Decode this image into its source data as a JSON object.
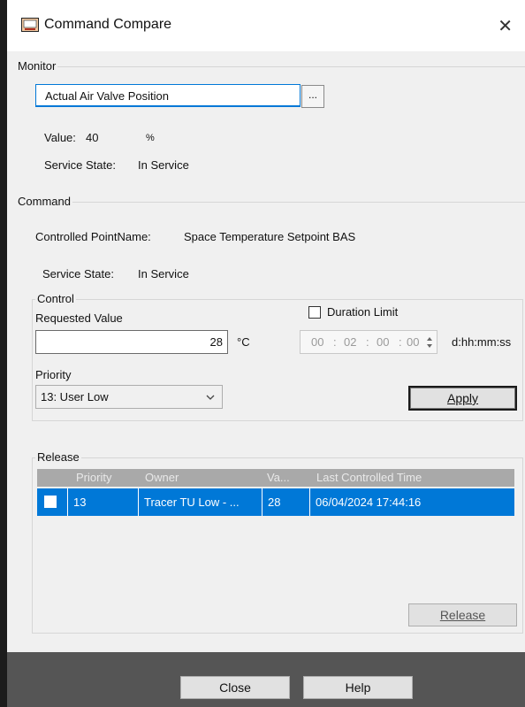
{
  "window": {
    "title": "Command Compare",
    "close_glyph": "✕"
  },
  "monitor": {
    "legend": "Monitor",
    "point": "Actual Air Valve Position",
    "browse_label": "...",
    "value_label": "Value:",
    "value": "40",
    "unit": "%",
    "service_state_label": "Service State:",
    "service_state": "In Service"
  },
  "command": {
    "legend": "Command",
    "controlled_point_label": "Controlled PointName:",
    "controlled_point": "Space Temperature Setpoint BAS",
    "service_state_label": "Service State:",
    "service_state": "In Service",
    "control": {
      "legend": "Control",
      "requested_value_label": "Requested Value",
      "requested_value": "28",
      "unit": "°C",
      "duration_limit_label": "Duration Limit",
      "duration_checked": false,
      "duration_d": "00",
      "duration_h": "02",
      "duration_m": "00",
      "duration_s": "00",
      "duration_sep": ":",
      "duration_format": "d:hh:mm:ss",
      "priority_label": "Priority",
      "priority_value": "13: User Low",
      "apply_label": "Apply"
    }
  },
  "release": {
    "legend": "Release",
    "columns": [
      "Priority",
      "Owner",
      "Va...",
      "Last Controlled Time"
    ],
    "rows": [
      {
        "checked": false,
        "priority": "13",
        "owner": "Tracer TU Low - ...",
        "value": "28",
        "time": "06/04/2024 17:44:16"
      }
    ],
    "release_label": "Release"
  },
  "footer": {
    "close_label": "Close",
    "help_label": "Help"
  },
  "colors": {
    "selection": "#0078d7",
    "footer": "#555555",
    "header": "#a9a9a9"
  }
}
